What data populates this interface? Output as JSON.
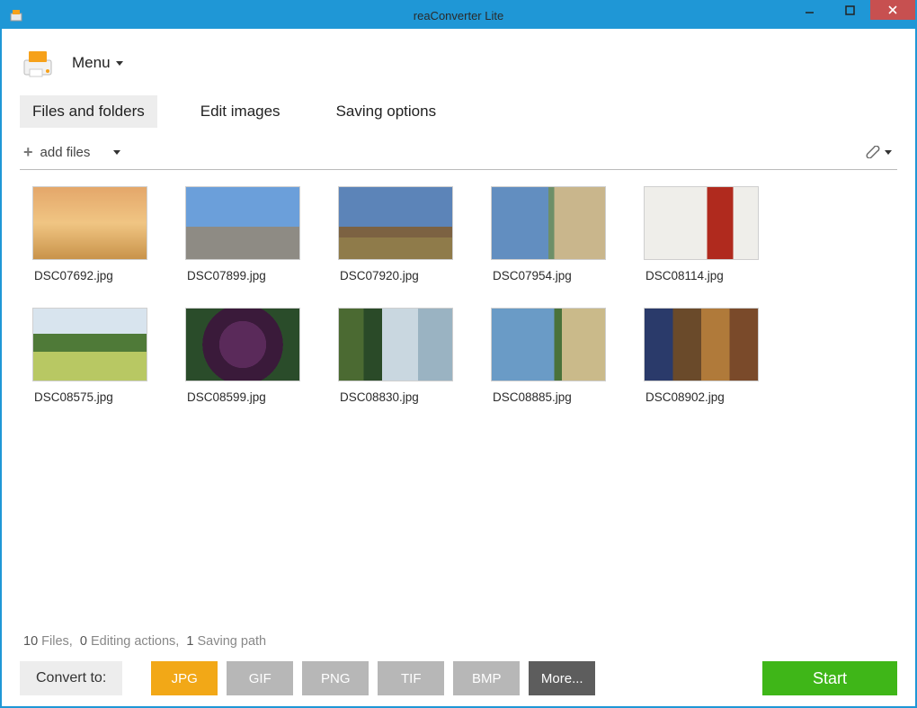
{
  "window": {
    "title": "reaConverter Lite"
  },
  "menu": {
    "label": "Menu"
  },
  "tabs": [
    {
      "label": "Files and folders",
      "active": true
    },
    {
      "label": "Edit images",
      "active": false
    },
    {
      "label": "Saving options",
      "active": false
    }
  ],
  "toolbar": {
    "add_files": "add files"
  },
  "files": [
    {
      "name": "DSC07692.jpg"
    },
    {
      "name": "DSC07899.jpg"
    },
    {
      "name": "DSC07920.jpg"
    },
    {
      "name": "DSC07954.jpg"
    },
    {
      "name": "DSC08114.jpg"
    },
    {
      "name": "DSC08575.jpg"
    },
    {
      "name": "DSC08599.jpg"
    },
    {
      "name": "DSC08830.jpg"
    },
    {
      "name": "DSC08885.jpg"
    },
    {
      "name": "DSC08902.jpg"
    }
  ],
  "status": {
    "files_count": "10",
    "files_label": "Files,",
    "actions_count": "0",
    "actions_label": "Editing actions,",
    "paths_count": "1",
    "paths_label": "Saving path"
  },
  "convert": {
    "label": "Convert to:",
    "formats": [
      "JPG",
      "GIF",
      "PNG",
      "TIF",
      "BMP"
    ],
    "more": "More...",
    "selected": "JPG",
    "start": "Start"
  }
}
